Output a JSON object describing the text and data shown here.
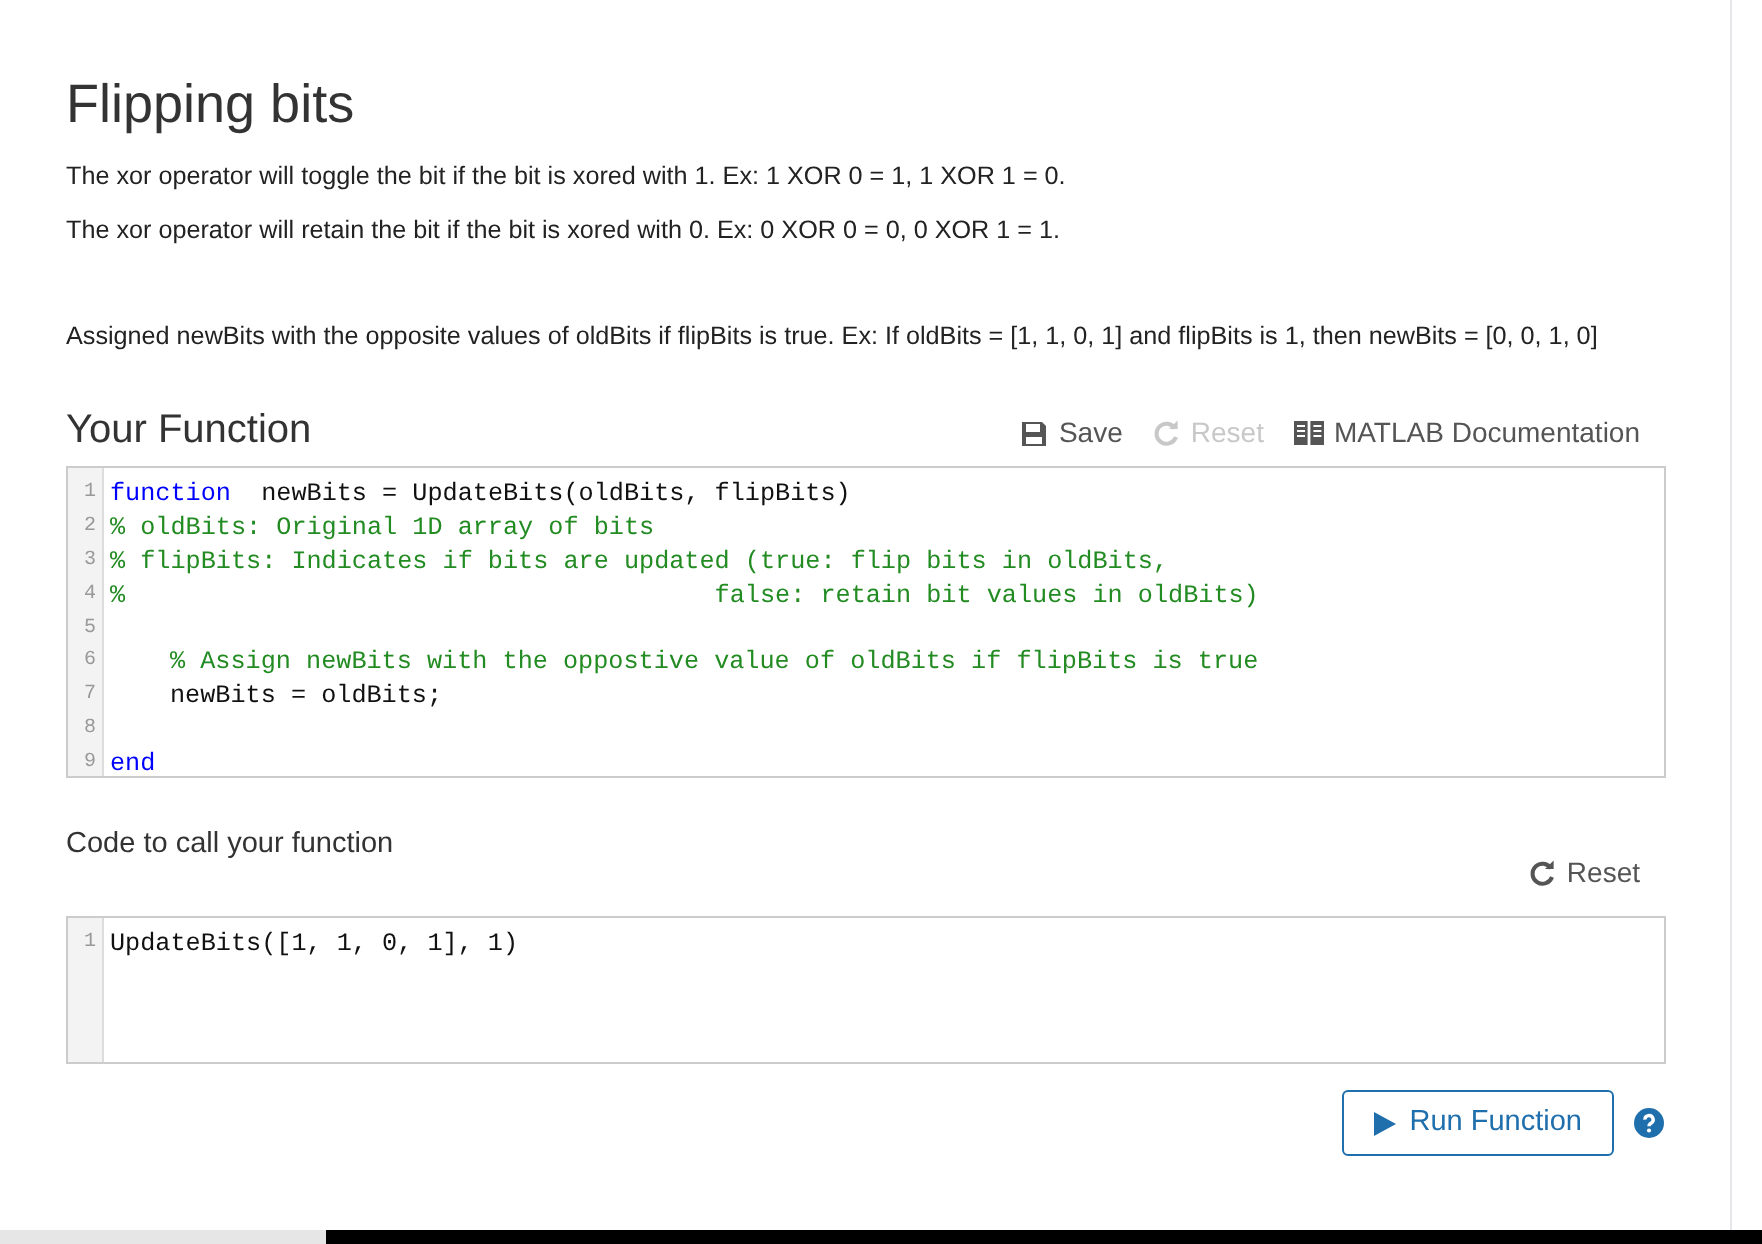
{
  "title": "Flipping bits",
  "paragraphs": [
    "The xor operator will toggle the bit if the bit is xored with 1. Ex: 1 XOR 0 = 1, 1 XOR 1 = 0.",
    "The xor operator will retain the bit if the bit is xored with 0. Ex: 0 XOR 0 = 0, 0 XOR 1 = 1.",
    "Assigned newBits with the opposite values of oldBits if flipBits is true. Ex: If oldBits = [1, 1, 0, 1] and flipBits is 1, then newBits = [0, 0, 1, 0]"
  ],
  "function_section": {
    "heading": "Your Function",
    "actions": [
      {
        "label": "Save",
        "kind": "save",
        "disabled": false
      },
      {
        "label": "Reset",
        "kind": "reset",
        "disabled": true
      },
      {
        "label": "MATLAB Documentation",
        "kind": "docs",
        "disabled": false
      }
    ],
    "editor": {
      "lines": [
        {
          "number": "1",
          "segments": [
            {
              "kind": "keyword",
              "text": "function"
            },
            {
              "kind": "plain",
              "text": "  newBits = UpdateBits(oldBits, flipBits)"
            }
          ]
        },
        {
          "number": "2",
          "segments": [
            {
              "kind": "comment",
              "text": "% oldBits: Original 1D array of bits"
            }
          ]
        },
        {
          "number": "3",
          "segments": [
            {
              "kind": "comment",
              "text": "% flipBits: Indicates if bits are updated (true: flip bits in oldBits,"
            }
          ]
        },
        {
          "number": "4",
          "segments": [
            {
              "kind": "comment",
              "text": "%                                       false: retain bit values in oldBits)"
            }
          ]
        },
        {
          "number": "5"
        },
        {
          "number": "6",
          "indented": true,
          "segments": [
            {
              "kind": "comment",
              "text": "% Assign newBits with the oppostive value of oldBits if flipBits is true"
            }
          ]
        },
        {
          "number": "7",
          "indented": true,
          "segments": [
            {
              "kind": "plain",
              "text": "newBits = oldBits;"
            }
          ]
        },
        {
          "number": "8"
        },
        {
          "number": "9",
          "segments": [
            {
              "kind": "keyword",
              "text": "end"
            }
          ]
        }
      ]
    }
  },
  "call_section": {
    "heading": "Code to call your function",
    "actions": [
      {
        "label": "Reset",
        "kind": "reset",
        "disabled": false
      }
    ],
    "editor": {
      "lines": [
        {
          "number": "1",
          "segments": [
            {
              "kind": "plain",
              "text": "UpdateBits([1, 1, 0, 1], 1)"
            }
          ]
        }
      ]
    }
  },
  "run_button": {
    "label": "Run Function"
  }
}
